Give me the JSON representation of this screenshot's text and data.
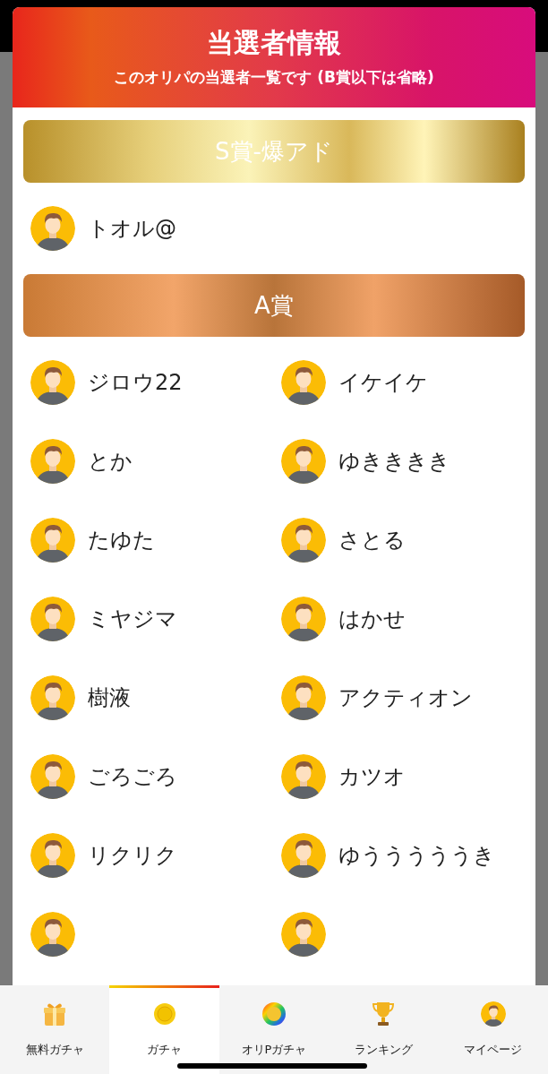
{
  "dialog": {
    "title": "当選者情報",
    "subtitle": "このオリパの当選者一覧です (B賞以下は省略)"
  },
  "prizes": [
    {
      "name": "S賞-爆アド",
      "kind": "gold",
      "winners": [
        "トオル@"
      ]
    },
    {
      "name": "A賞",
      "kind": "bronze",
      "winners": [
        "ジロウ22",
        "イケイケ",
        "とか",
        "ゆきききき",
        "たゆた",
        "さとる",
        "ミヤジマ",
        "はかせ",
        "樹液",
        "アクティオン",
        "ごろごろ",
        "カツオ",
        "リクリク",
        "ゆうううううき"
      ]
    }
  ],
  "nav": [
    {
      "label": "無料ガチャ",
      "kind": "gift",
      "selected": false
    },
    {
      "label": "ガチャ",
      "kind": "coin",
      "selected": true
    },
    {
      "label": "オリPガチャ",
      "kind": "badge",
      "selected": false
    },
    {
      "label": "ランキング",
      "kind": "trophy",
      "selected": false
    },
    {
      "label": "マイページ",
      "kind": "avatar",
      "selected": false
    }
  ]
}
